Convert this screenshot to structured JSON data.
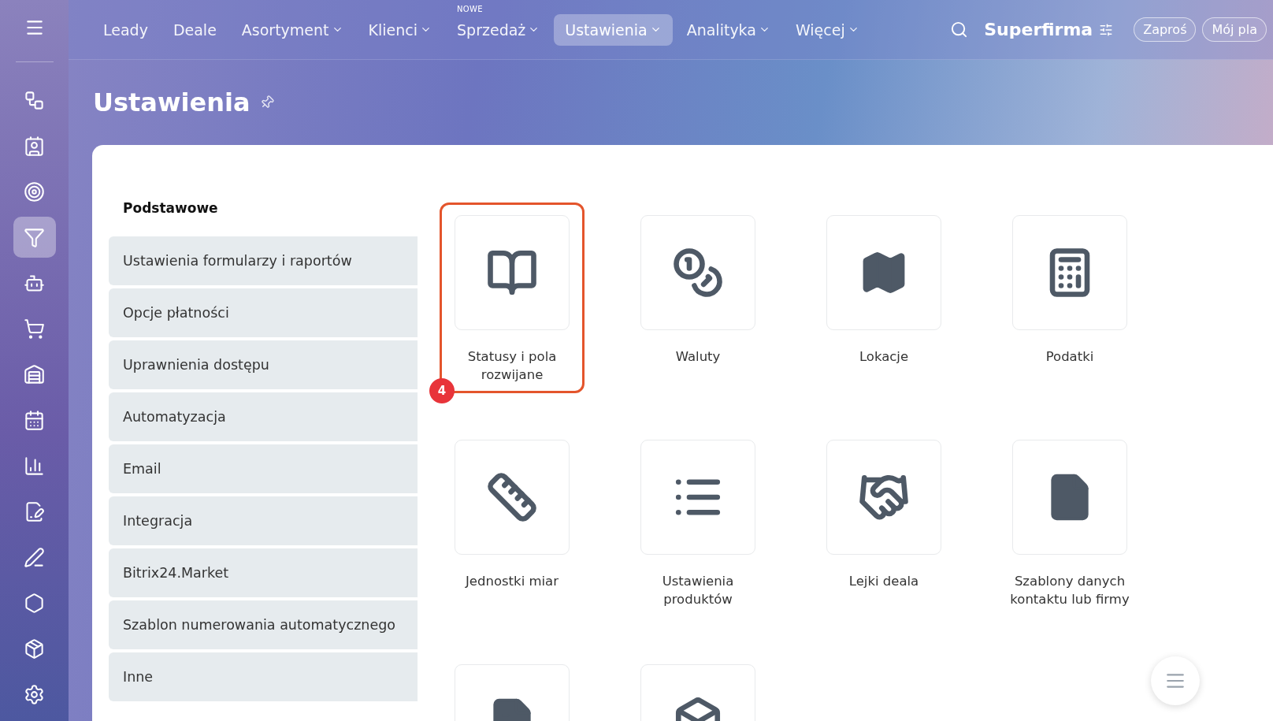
{
  "top_nav": {
    "items": [
      {
        "label": "Leady",
        "dropdown": false,
        "selected": false
      },
      {
        "label": "Deale",
        "dropdown": false,
        "selected": false
      },
      {
        "label": "Asortyment",
        "dropdown": true,
        "selected": false
      },
      {
        "label": "Klienci",
        "dropdown": true,
        "selected": false
      },
      {
        "label": "Sprzedaż",
        "dropdown": true,
        "selected": false,
        "badge": "NOWE"
      },
      {
        "label": "Ustawienia",
        "dropdown": true,
        "selected": true
      },
      {
        "label": "Analityka",
        "dropdown": true,
        "selected": false
      },
      {
        "label": "Więcej",
        "dropdown": true,
        "selected": false
      }
    ],
    "company": "Superfirma",
    "buttons": [
      "Zaproś",
      "Mój pla"
    ]
  },
  "rail": {
    "items": [
      {
        "kind": "flow",
        "selected": false
      },
      {
        "kind": "contact",
        "selected": false
      },
      {
        "kind": "target",
        "selected": false
      },
      {
        "kind": "funnel",
        "selected": true
      },
      {
        "kind": "robot",
        "selected": false
      },
      {
        "kind": "cart",
        "selected": false
      },
      {
        "kind": "store",
        "selected": false
      },
      {
        "kind": "calendar",
        "selected": false
      },
      {
        "kind": "chart",
        "selected": false
      },
      {
        "kind": "document",
        "selected": false
      },
      {
        "kind": "pen",
        "selected": false
      },
      {
        "kind": "hexagon",
        "selected": false
      },
      {
        "kind": "box",
        "selected": false
      },
      {
        "kind": "gear",
        "selected": false
      }
    ]
  },
  "page_title": "Ustawienia",
  "menu": {
    "heading": "Podstawowe",
    "items": [
      "Ustawienia formularzy i raportów",
      "Opcje płatności",
      "Uprawnienia dostępu",
      "Automatyzacja",
      "Email",
      "Integracja",
      "Bitrix24.Market",
      "Szablon numerowania automatycznego",
      "Inne"
    ]
  },
  "tiles": [
    {
      "kind": "book",
      "label": "Statusy i pola rozwijane",
      "highlighted": true,
      "badge": "4"
    },
    {
      "kind": "coins",
      "label": "Waluty",
      "highlighted": false
    },
    {
      "kind": "map",
      "label": "Lokacje",
      "highlighted": false
    },
    {
      "kind": "calculator",
      "label": "Podatki",
      "highlighted": false
    },
    {
      "kind": "ruler",
      "label": "Jednostki miar",
      "highlighted": false
    },
    {
      "kind": "list",
      "label": "Ustawienia produktów",
      "highlighted": false
    },
    {
      "kind": "handshake",
      "label": "Lejki deala",
      "highlighted": false
    },
    {
      "kind": "file",
      "label": "Szablony danych kontaktu lub firmy",
      "highlighted": false
    },
    {
      "kind": "doc",
      "highlighted": false
    },
    {
      "kind": "cube",
      "highlighted": false
    }
  ]
}
